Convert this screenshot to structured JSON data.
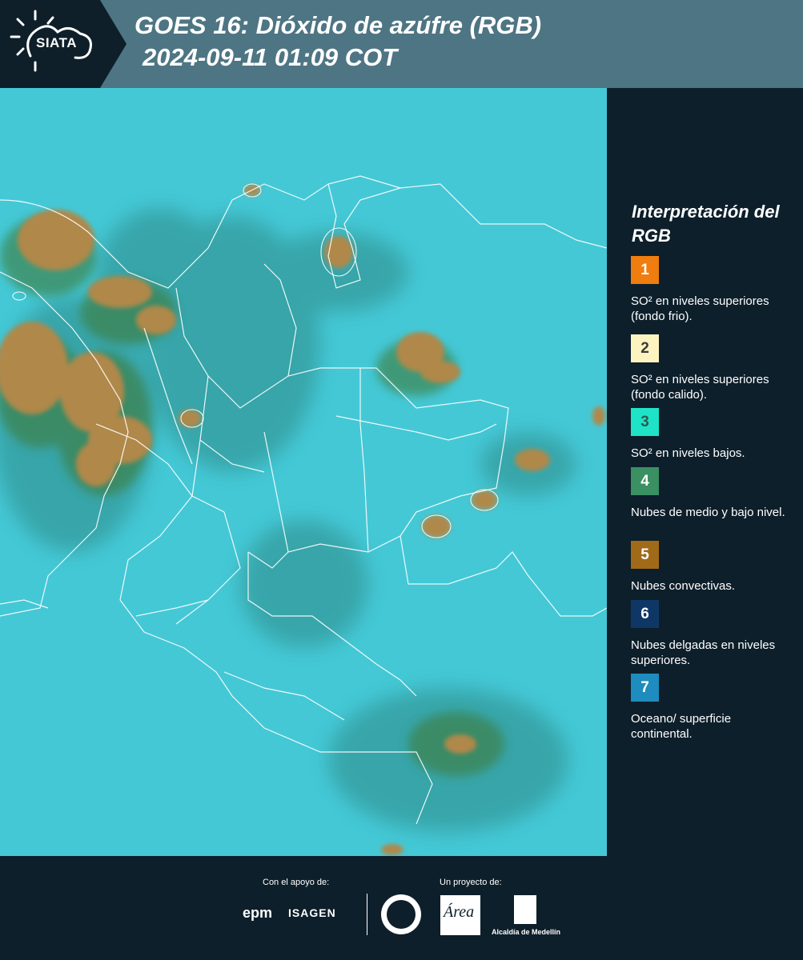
{
  "header": {
    "logo_text": "SIATA",
    "title_line1": "GOES 16: Dióxido de azúfre (RGB)",
    "title_line2": "2024-09-11 01:09 COT"
  },
  "map": {
    "image_type": "satellite-rgb-composite",
    "background_color": "#3fc6d6",
    "boundary_color": "#ffffff"
  },
  "legend": {
    "title": "Interpretación del RGB",
    "items": [
      {
        "number": "1",
        "color": "#f07d0f",
        "text_color": "#ffffff",
        "label": "SO² en niveles superiores (fondo frio)."
      },
      {
        "number": "2",
        "color": "#fcf3c0",
        "text_color": "#3a3a3a",
        "label": "SO² en niveles superiores (fondo calido)."
      },
      {
        "number": "3",
        "color": "#1fe3c6",
        "text_color": "#2b5b55",
        "label": "SO² en niveles bajos."
      },
      {
        "number": "4",
        "color": "#3a8f63",
        "text_color": "#ffffff",
        "label": "Nubes de medio y bajo nivel."
      },
      {
        "number": "5",
        "color": "#a06a18",
        "text_color": "#ffffff",
        "label": "Nubes convectivas."
      },
      {
        "number": "6",
        "color": "#0f3766",
        "text_color": "#ffffff",
        "label": "Nubes delgadas en niveles superiores."
      },
      {
        "number": "7",
        "color": "#1e8cbe",
        "text_color": "#ffffff",
        "label": "Oceano/ superficie continental."
      }
    ]
  },
  "footer": {
    "support_label": "Con el apoyo de:",
    "project_label": "Un proyecto de:",
    "epm_text": "epm",
    "isagen_text": "ISAGEN",
    "area_text": "Área",
    "alcaldia_text": "Alcaldía de Medellín"
  }
}
